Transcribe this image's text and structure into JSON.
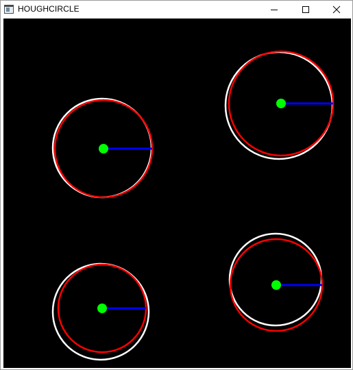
{
  "window": {
    "title": "HOUGHCIRCLE",
    "icon": "app-window-icon",
    "controls": [
      {
        "name": "minimize",
        "icon": "minimize-icon"
      },
      {
        "name": "maximize",
        "icon": "maximize-icon"
      },
      {
        "name": "close",
        "icon": "close-icon"
      }
    ]
  },
  "canvas": {
    "background": "#000000",
    "colors": {
      "original_circle": "#ffffff",
      "detected_circle": "#ff0000",
      "center_point": "#00ff00",
      "radius_line": "#0000ff"
    },
    "shapes": [
      {
        "id": "top-left",
        "original": [
          144,
          189,
          72
        ],
        "detected": [
          146,
          190,
          71
        ]
      },
      {
        "id": "top-right",
        "original": [
          402,
          127,
          78
        ],
        "detected": [
          405,
          124,
          76
        ]
      },
      {
        "id": "bottom-left",
        "original": [
          142,
          428,
          70
        ],
        "detected": [
          144,
          423,
          64
        ]
      },
      {
        "id": "bottom-right",
        "original": [
          397,
          381,
          67
        ],
        "detected": [
          398,
          389,
          67
        ]
      }
    ]
  }
}
